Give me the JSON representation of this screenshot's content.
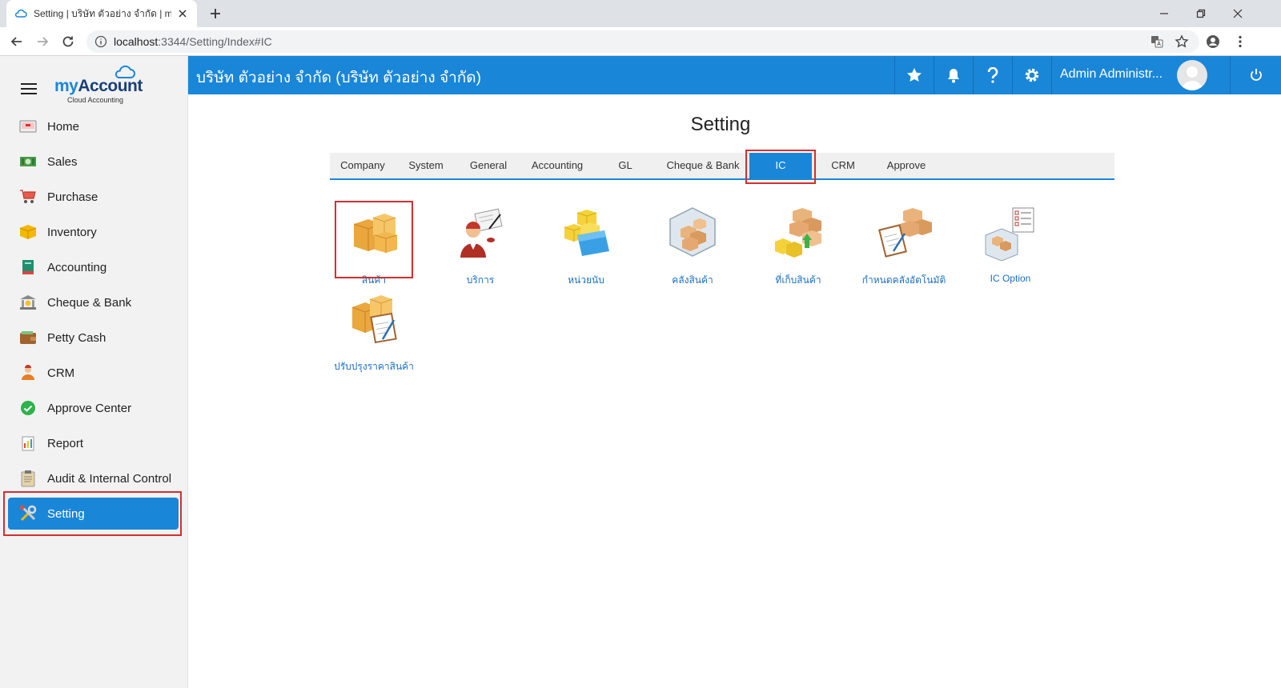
{
  "browser": {
    "tab_title": "Setting | บริษัท ตัวอย่าง จำกัด | myA",
    "url_host": "localhost",
    "url_path": ":3344/Setting/Index#IC"
  },
  "sidebar": {
    "logo": {
      "my": "my",
      "account": "Account",
      "tagline": "Cloud Accounting"
    },
    "items": [
      {
        "label": "Home",
        "icon": "home-icon"
      },
      {
        "label": "Sales",
        "icon": "sales-icon"
      },
      {
        "label": "Purchase",
        "icon": "cart-icon"
      },
      {
        "label": "Inventory",
        "icon": "box-icon"
      },
      {
        "label": "Accounting",
        "icon": "ledger-icon"
      },
      {
        "label": "Cheque & Bank",
        "icon": "bank-icon"
      },
      {
        "label": "Petty Cash",
        "icon": "wallet-icon"
      },
      {
        "label": "CRM",
        "icon": "people-icon"
      },
      {
        "label": "Approve Center",
        "icon": "check-circle-icon"
      },
      {
        "label": "Report",
        "icon": "report-icon"
      },
      {
        "label": "Audit & Internal Control",
        "icon": "clipboard-icon"
      },
      {
        "label": "Setting",
        "icon": "tools-icon",
        "active": true
      }
    ]
  },
  "header": {
    "company": "บริษัท ตัวอย่าง จำกัด (บริษัท ตัวอย่าง จำกัด)",
    "user_name": "Admin Administr..."
  },
  "main": {
    "title": "Setting",
    "tabs": [
      {
        "label": "Company"
      },
      {
        "label": "System"
      },
      {
        "label": "General"
      },
      {
        "label": "Accounting"
      },
      {
        "label": "GL"
      },
      {
        "label": "Cheque & Bank"
      },
      {
        "label": "IC",
        "active": true
      },
      {
        "label": "CRM"
      },
      {
        "label": "Approve"
      }
    ],
    "tiles": [
      {
        "label": "สินค้า",
        "icon": "product-boxes-icon"
      },
      {
        "label": "บริการ",
        "icon": "service-person-icon"
      },
      {
        "label": "หน่วยนับ",
        "icon": "unit-folder-icon"
      },
      {
        "label": "คลังสินค้า",
        "icon": "warehouse-icon"
      },
      {
        "label": "ที่เก็บสินค้า",
        "icon": "storage-location-icon"
      },
      {
        "label": "กำหนดคลังอัตโนมัติ",
        "icon": "auto-warehouse-icon"
      },
      {
        "label": "IC Option",
        "icon": "ic-option-icon"
      },
      {
        "label": "ปรับปรุงราคาสินค้า",
        "icon": "price-adjust-icon"
      }
    ]
  },
  "colors": {
    "brand": "#1a86d8",
    "highlight": "#d32f2f",
    "link": "#1a6fc2"
  }
}
